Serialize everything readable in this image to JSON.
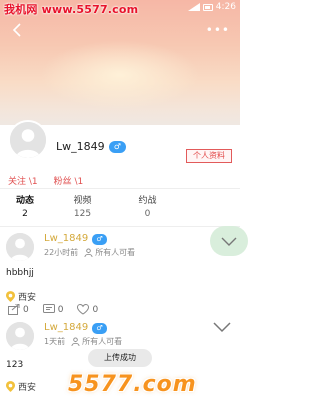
{
  "watermark": {
    "top": "我机网 www.5577.com",
    "bottom": "5577.com"
  },
  "status_bar": {
    "time": "4:26"
  },
  "profile": {
    "username": "Lw_1849",
    "gender": "♂",
    "profile_button": "个人资料",
    "follow_label": "关注 \\1",
    "fans_label": "粉丝 \\1"
  },
  "stats": [
    {
      "label": "动态",
      "value": "2"
    },
    {
      "label": "视频",
      "value": "125"
    },
    {
      "label": "约战",
      "value": "0"
    }
  ],
  "posts": [
    {
      "username": "Lw_1849",
      "gender": "♂",
      "time": "22小时前",
      "visibility": "所有人可看",
      "text": "hbbhjj",
      "location": "西安",
      "shares": "0",
      "comments": "0",
      "likes": "0"
    },
    {
      "username": "Lw_1849",
      "gender": "♂",
      "time": "1天前",
      "visibility": "所有人可看",
      "text": "123",
      "location": "西安"
    }
  ],
  "toast": "上传成功",
  "colors": {
    "accent_red": "#e05050",
    "username_gold": "#d4a93c",
    "gender_blue": "#3a9ff5"
  },
  "icons": [
    "back-arrow-icon",
    "more-dots-icon",
    "chevron-down-icon",
    "location-pin-icon",
    "share-icon",
    "comment-icon",
    "heart-icon"
  ]
}
